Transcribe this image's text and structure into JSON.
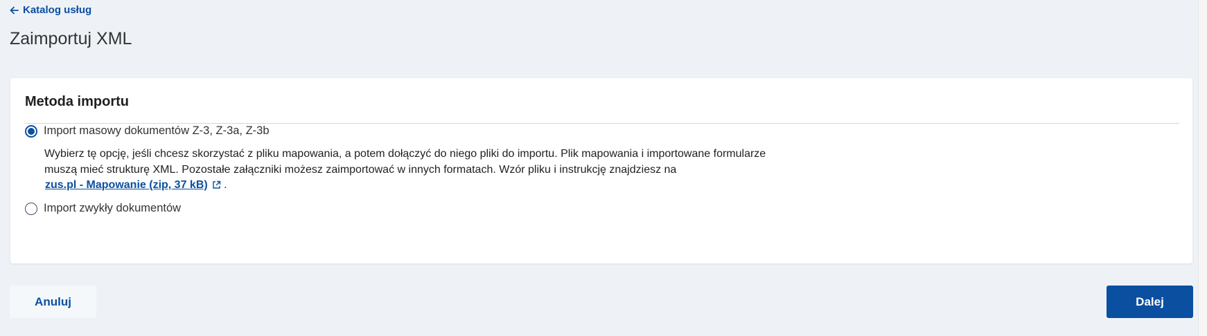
{
  "header": {
    "back_link_label": "Katalog usług",
    "page_title": "Zaimportuj XML"
  },
  "card": {
    "title": "Metoda importu",
    "options": [
      {
        "label": "Import masowy dokumentów Z-3, Z-3a, Z-3b",
        "selected": true,
        "description": "Wybierz tę opcję, jeśli chcesz skorzystać z pliku mapowania, a potem dołączyć do niego pliki do importu. Plik mapowania i importowane formularze muszą mieć strukturę XML. Pozostałe załączniki możesz zaimportować w innych formatach. Wzór pliku i instrukcję znajdziesz na",
        "link_text": "zus.pl - Mapowanie (zip, 37 kB)",
        "suffix": "."
      },
      {
        "label": "Import zwykły dokumentów",
        "selected": false
      }
    ]
  },
  "footer": {
    "cancel_label": "Anuluj",
    "next_label": "Dalej"
  },
  "icons": {
    "back": "arrow-left-icon",
    "external": "external-link-icon"
  },
  "colors": {
    "accent": "#0b4fa0",
    "background": "#eef2f7",
    "card": "#ffffff"
  }
}
